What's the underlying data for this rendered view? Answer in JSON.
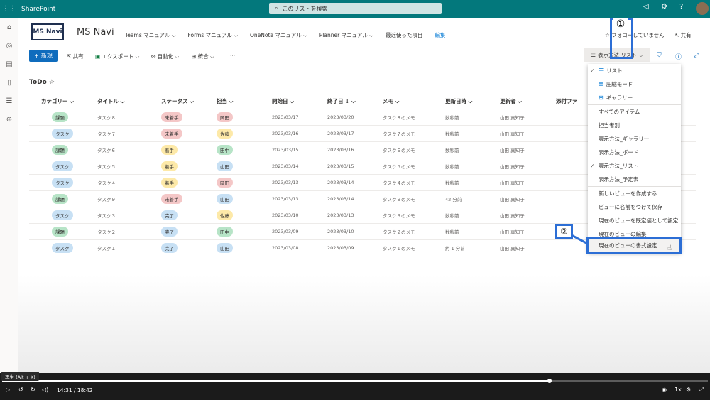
{
  "topbar": {
    "brand": "SharePoint",
    "search_placeholder": "このリストを検索"
  },
  "site": {
    "logo_text": "MS Navi",
    "name": "MS Navi",
    "nav": [
      "Teams マニュアル",
      "Forms マニュアル",
      "OneNote マニュアル",
      "Planner マニュアル",
      "最近使った項目",
      "編集"
    ],
    "follow": "フォローしていません",
    "share": "共有"
  },
  "commands": {
    "new": "新規",
    "share": "共有",
    "export": "エクスポート",
    "automate": "自動化",
    "integrate": "統合",
    "more": "···"
  },
  "view_selector": "表示方法 リスト",
  "callouts": {
    "one": "①",
    "two": "②"
  },
  "list": {
    "title": "ToDo",
    "columns": [
      "カテゴリー",
      "タイトル",
      "ステータス",
      "担当",
      "開始日",
      "終了日 ↓",
      "メモ",
      "更新日時",
      "更新者",
      "添付ファ"
    ],
    "rows": [
      {
        "category": "課題",
        "title": "タスク８",
        "status": "未着手",
        "owner": "岡田",
        "start": "2023/03/17",
        "end": "2023/03/20",
        "memo": "タスク８のメモ",
        "modified": "数秒前",
        "editor": "山田 真知子"
      },
      {
        "category": "タスク",
        "title": "タスク７",
        "status": "未着手",
        "owner": "佐藤",
        "start": "2023/03/16",
        "end": "2023/03/17",
        "memo": "タスク７のメモ",
        "modified": "数秒前",
        "editor": "山田 真知子"
      },
      {
        "category": "課題",
        "title": "タスク６",
        "status": "着手",
        "owner": "田中",
        "start": "2023/03/15",
        "end": "2023/03/16",
        "memo": "タスク６のメモ",
        "modified": "数秒前",
        "editor": "山田 真知子"
      },
      {
        "category": "タスク",
        "title": "タスク５",
        "status": "着手",
        "owner": "山田",
        "start": "2023/03/14",
        "end": "2023/03/15",
        "memo": "タスク５のメモ",
        "modified": "数秒前",
        "editor": "山田 真知子"
      },
      {
        "category": "タスク",
        "title": "タスク４",
        "status": "着手",
        "owner": "岡田",
        "start": "2023/03/13",
        "end": "2023/03/14",
        "memo": "タスク４のメモ",
        "modified": "数秒前",
        "editor": "山田 真知子"
      },
      {
        "category": "課題",
        "title": "タスク９",
        "status": "未着手",
        "owner": "山田",
        "start": "2023/03/13",
        "end": "2023/03/14",
        "memo": "タスク９のメモ",
        "modified": "42 分前",
        "editor": "山田 真知子"
      },
      {
        "category": "タスク",
        "title": "タスク３",
        "status": "完了",
        "owner": "佐藤",
        "start": "2023/03/10",
        "end": "2023/03/13",
        "memo": "タスク３のメモ",
        "modified": "数秒前",
        "editor": "山田 真知子"
      },
      {
        "category": "課題",
        "title": "タスク２",
        "status": "完了",
        "owner": "田中",
        "start": "2023/03/09",
        "end": "2023/03/10",
        "memo": "タスク２のメモ",
        "modified": "数秒前",
        "editor": "山田 真知子"
      },
      {
        "category": "タスク",
        "title": "タスク１",
        "status": "完了",
        "owner": "山田",
        "start": "2023/03/08",
        "end": "2023/03/09",
        "memo": "タスク１のメモ",
        "modified": "約 1 分前",
        "editor": "山田 真知子"
      }
    ]
  },
  "pill_colors": {
    "課題": "#b7e4c7",
    "タスク": "#c7e0f4",
    "未着手": "#f4c7c7",
    "着手": "#fde9a8",
    "完了": "#c7e0f4",
    "岡田": "#f4c7c7",
    "佐藤": "#fde9a8",
    "田中": "#b7e4c7",
    "山田": "#c7e0f4"
  },
  "view_menu": {
    "layouts": [
      "リスト",
      "圧縮モード",
      "ギャラリー"
    ],
    "views": [
      "すべてのアイテム",
      "担当者別",
      "表示方法_ギャラリー",
      "表示方法_ボード",
      "表示方法_リスト",
      "表示方法_予定表"
    ],
    "actions": [
      "新しいビューを作成する",
      "ビューに名前をつけて保存",
      "現在のビューを既定値として設定",
      "現在のビューの編集",
      "現在のビューの書式設定"
    ]
  },
  "player": {
    "tooltip": "再生 (Alt + K)",
    "time": "14:31 / 18:42",
    "speed": "1x",
    "progress": 0.776
  }
}
